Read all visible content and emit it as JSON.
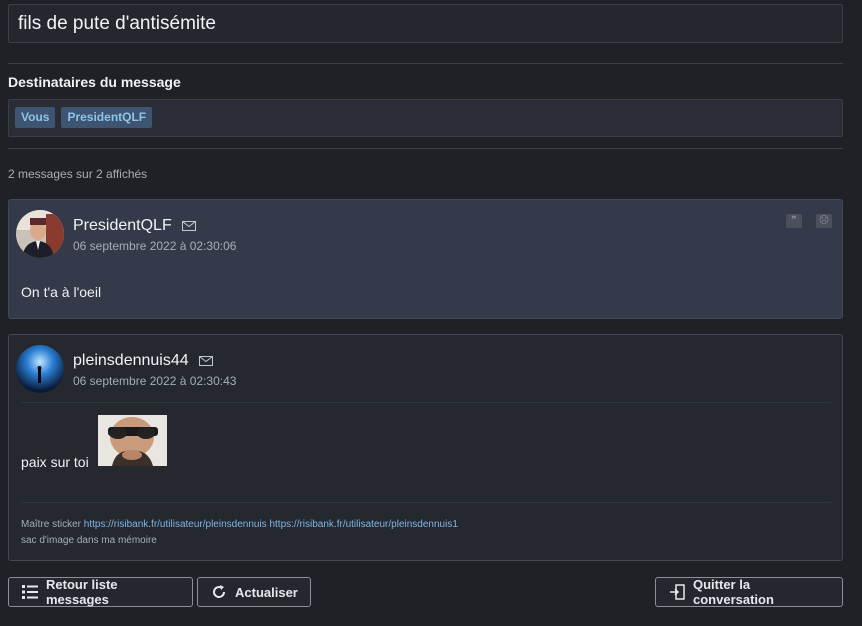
{
  "conversation": {
    "title": "fils de pute d'antisémite"
  },
  "recipients": {
    "label": "Destinataires du message",
    "tags": [
      "Vous",
      "PresidentQLF"
    ]
  },
  "messages_count": "2 messages sur 2 affichés",
  "messages": [
    {
      "author": "PresidentQLF",
      "date": "06 septembre 2022 à 02:30:06",
      "body": "On t'a à l'oeil",
      "icons": [
        "quote-icon",
        "report-icon"
      ]
    },
    {
      "author": "pleinsdennuis44",
      "date": "06 septembre 2022 à 02:30:43",
      "body": "paix sur toi",
      "signature": {
        "prefix": "Maître sticker ",
        "link1": "https://risibank.fr/utilisateur/pleinsdennuis",
        "link2": "https://risibank.fr/utilisateur/pleinsdennuis1",
        "line2": "sac d'image dans ma mémoire"
      }
    }
  ],
  "actions": {
    "back_label": "Retour liste messages",
    "refresh_label": "Actualiser",
    "leave_label": "Quitter la conversation"
  },
  "colors": {
    "background": "#1f2127",
    "accent": "#8fc3ec",
    "tag_bg": "#3d5570",
    "highlight_message": "#343a49"
  }
}
